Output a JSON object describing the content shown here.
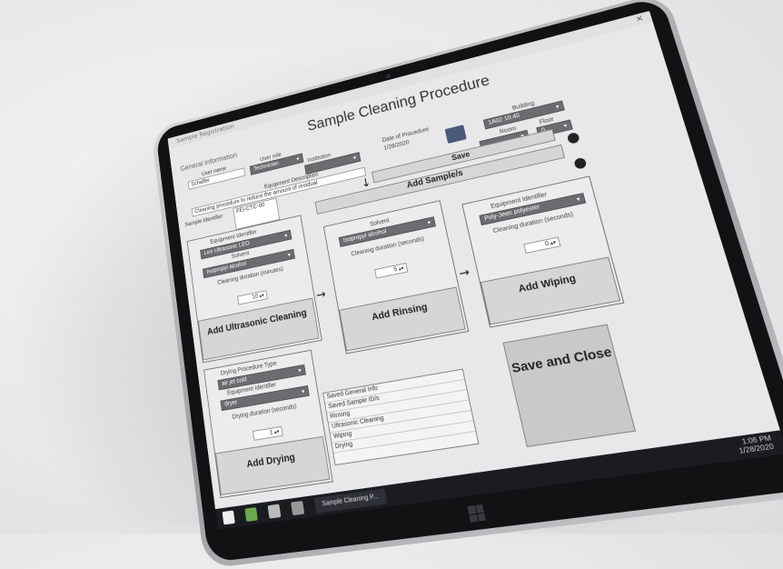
{
  "window": {
    "title": "Sample Cleaning Procedure",
    "titlebar_text": "Sample Registration"
  },
  "general": {
    "section_label": "General information",
    "user_name_label": "User name",
    "user_name_value": "Schaffer",
    "user_role_label": "User role",
    "user_role_value": "Technician",
    "institution_label": "Institution",
    "date_label": "Date of Procedure",
    "date_value": "1/28/2020",
    "equipment_description_label": "Equipment Description",
    "equipment_description_value": "Cleaning procedure to reduce the amount of residual",
    "building_label": "Building",
    "building_value": "1A02 10.40",
    "room_label": "Room",
    "floor_label": "Floor",
    "floor_value": "0",
    "sample_identifier_label": "Sample Identifier",
    "sample_identifier_value": "FEI-CTC-00"
  },
  "buttons": {
    "save": "Save",
    "add_samples": "Add Sample/s",
    "add_ultrasonic": "Add Ultrasonic Cleaning",
    "add_rinsing": "Add Rinsing",
    "add_wiping": "Add Wiping",
    "add_drying": "Add Drying",
    "save_and_close": "Save and Close"
  },
  "ultrasonic": {
    "equipment_label": "Equipment Identifier",
    "equipment_value": "Leo Ultrasonic LEO",
    "solvent_label": "Solvent",
    "solvent_value": "Isopropyl alcohol",
    "duration_label": "Cleaning duration (minutes)",
    "duration_value": "10"
  },
  "rinsing": {
    "solvent_label": "Solvent",
    "solvent_value": "Isopropyl alcohol",
    "duration_label": "Cleaning duration (seconds)",
    "duration_value": "5"
  },
  "wiping": {
    "equipment_label": "Equipment Identifier",
    "equipment_value": "Poly-Jeen polyester",
    "duration_label": "Cleaning duration (seconds)",
    "duration_value": "0"
  },
  "drying": {
    "type_label": "Drying Procedure Type",
    "type_value": "air jet cold",
    "equipment_label": "Equipment Identifier",
    "equipment_value": "dryer",
    "duration_label": "Drying duration (seconds)",
    "duration_value": "1"
  },
  "log": {
    "items": [
      "Saved General Info",
      "Saved Sample ID/s",
      "Rinsing",
      "Ultrasonic Cleaning",
      "Wiping",
      "Drying"
    ]
  },
  "taskbar": {
    "app_label": "Sample Cleaning P...",
    "time": "1:06 PM",
    "date": "1/28/2020"
  },
  "colors": {
    "screen_bg": "#e8e8ea",
    "bezel": "#121214",
    "button_bg": "#d6d6d8",
    "dropdown_bg": "#6c6c70",
    "taskbar_bg": "#1b1c20"
  }
}
